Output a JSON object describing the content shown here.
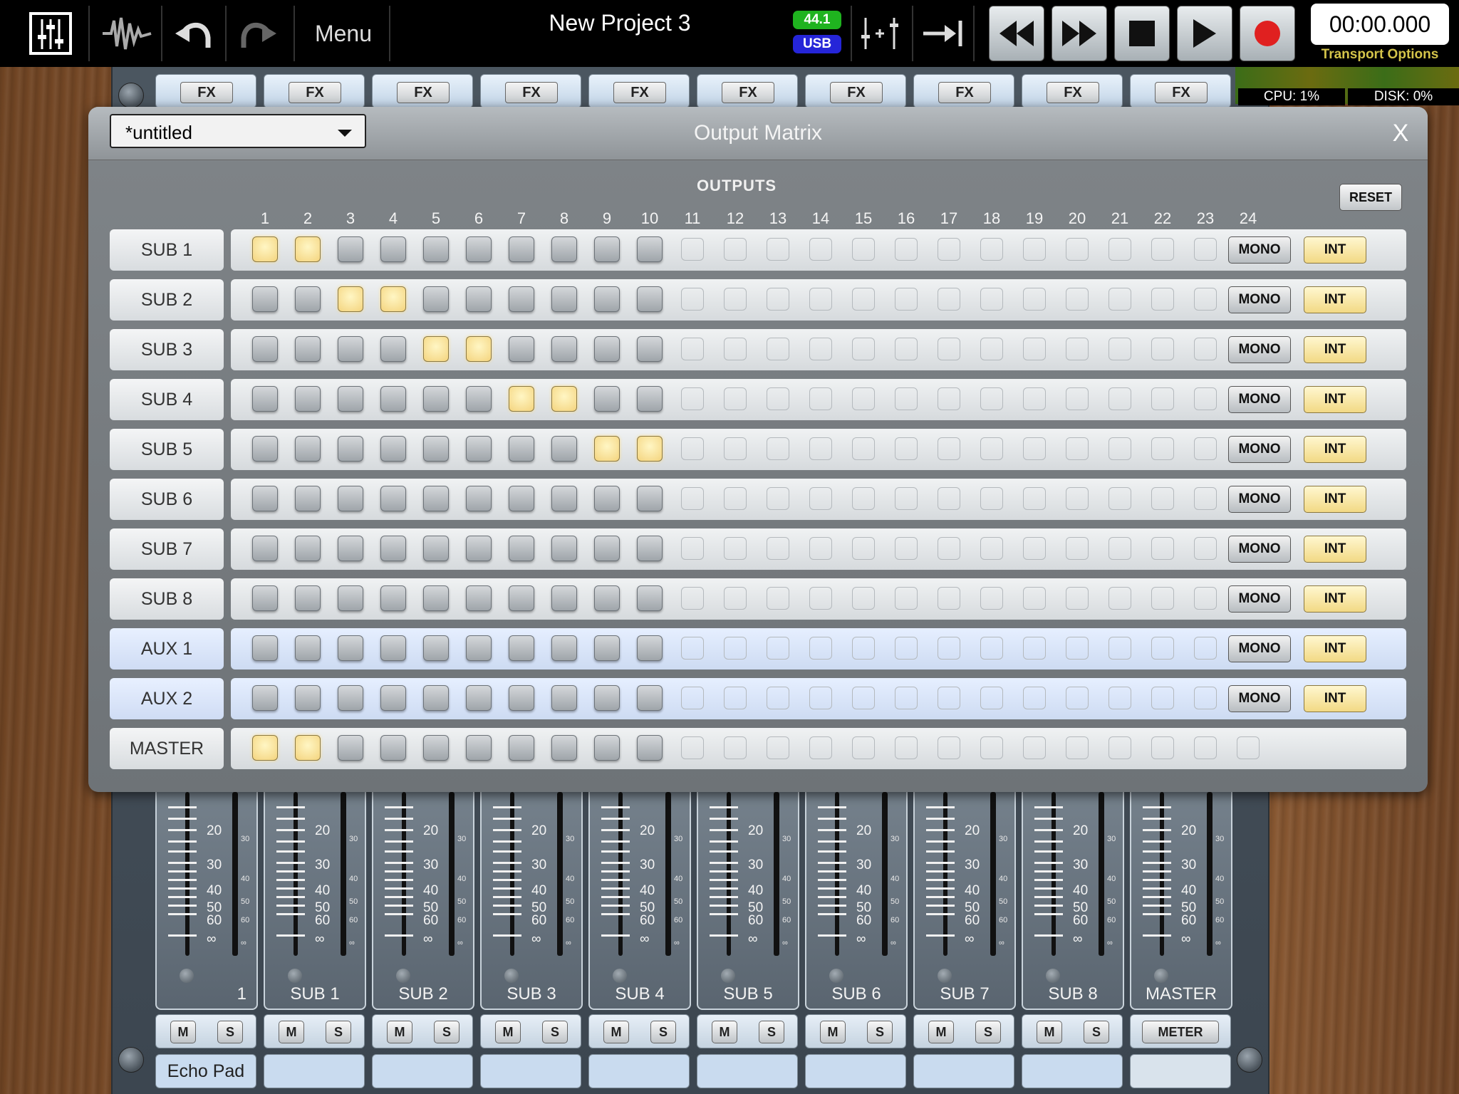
{
  "topbar": {
    "menu_label": "Menu",
    "project_title": "New Project 3",
    "sample_rate": "44.1",
    "interface": "USB",
    "time": "00:00.000",
    "transport_options_label": "Transport Options",
    "colors": {
      "record": "#e02020",
      "rate_badge": "#1fb31f",
      "usb_badge": "#2525d8"
    }
  },
  "meters": {
    "cpu": "CPU:  1%",
    "disk": "DISK:  0%"
  },
  "fx_label": "FX",
  "matrix": {
    "preset": "*untitled",
    "title": "Output Matrix",
    "close_label": "X",
    "outputs_label": "OUTPUTS",
    "reset_label": "RESET",
    "mono_label": "MONO",
    "int_label": "INT",
    "columns": [
      "1",
      "2",
      "3",
      "4",
      "5",
      "6",
      "7",
      "8",
      "9",
      "10",
      "11",
      "12",
      "13",
      "14",
      "15",
      "16",
      "17",
      "18",
      "19",
      "20",
      "21",
      "22",
      "23",
      "24"
    ],
    "active_columns": 10,
    "rows": [
      {
        "label": "SUB 1",
        "aux": false,
        "on": [
          1,
          2
        ],
        "buttons": true
      },
      {
        "label": "SUB 2",
        "aux": false,
        "on": [
          3,
          4
        ],
        "buttons": true
      },
      {
        "label": "SUB 3",
        "aux": false,
        "on": [
          5,
          6
        ],
        "buttons": true
      },
      {
        "label": "SUB 4",
        "aux": false,
        "on": [
          7,
          8
        ],
        "buttons": true
      },
      {
        "label": "SUB 5",
        "aux": false,
        "on": [
          9,
          10
        ],
        "buttons": true
      },
      {
        "label": "SUB 6",
        "aux": false,
        "on": [],
        "buttons": true
      },
      {
        "label": "SUB 7",
        "aux": false,
        "on": [],
        "buttons": true
      },
      {
        "label": "SUB 8",
        "aux": false,
        "on": [],
        "buttons": true
      },
      {
        "label": "AUX 1",
        "aux": true,
        "on": [],
        "buttons": true
      },
      {
        "label": "AUX 2",
        "aux": true,
        "on": [],
        "buttons": true
      },
      {
        "label": "MASTER",
        "aux": false,
        "on": [
          1,
          2
        ],
        "buttons": false
      }
    ]
  },
  "strips": {
    "fader_scale": [
      "20",
      "30",
      "40",
      "50",
      "60",
      "∞"
    ],
    "meter_scale": [
      "30",
      "40",
      "50",
      "60",
      "∞"
    ],
    "mute_label": "M",
    "solo_label": "S",
    "meter_label": "METER",
    "channels": [
      {
        "name": "1",
        "track_name": "Echo Pad",
        "type": "track"
      },
      {
        "name": "SUB 1",
        "track_name": "",
        "type": "sub"
      },
      {
        "name": "SUB 2",
        "track_name": "",
        "type": "sub"
      },
      {
        "name": "SUB 3",
        "track_name": "",
        "type": "sub"
      },
      {
        "name": "SUB 4",
        "track_name": "",
        "type": "sub"
      },
      {
        "name": "SUB 5",
        "track_name": "",
        "type": "sub"
      },
      {
        "name": "SUB 6",
        "track_name": "",
        "type": "sub"
      },
      {
        "name": "SUB 7",
        "track_name": "",
        "type": "sub"
      },
      {
        "name": "SUB 8",
        "track_name": "",
        "type": "sub"
      },
      {
        "name": "MASTER",
        "track_name": "",
        "type": "master"
      }
    ]
  }
}
